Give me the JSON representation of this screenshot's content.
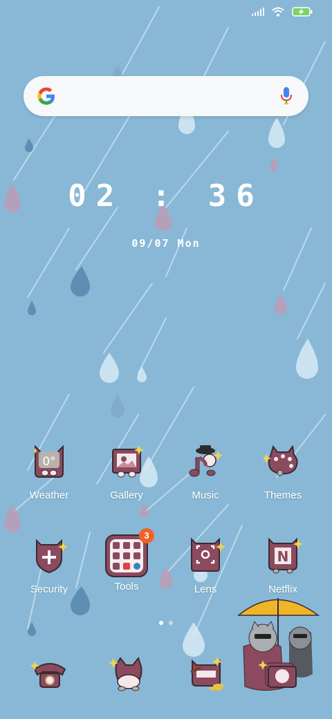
{
  "status_bar": {
    "signal_icon": "signal-icon",
    "wifi_icon": "wifi-icon",
    "battery_icon": "battery-charging-icon"
  },
  "search": {
    "logo": "google-g-icon",
    "mic": "mic-icon"
  },
  "clock": {
    "time": "02 : 36",
    "date": "09/07 Mon"
  },
  "apps": [
    {
      "label": "Weather",
      "icon": "weather-icon",
      "temp": "0°"
    },
    {
      "label": "Gallery",
      "icon": "gallery-icon"
    },
    {
      "label": "Music",
      "icon": "music-icon"
    },
    {
      "label": "Themes",
      "icon": "themes-icon"
    },
    {
      "label": "Security",
      "icon": "security-icon"
    },
    {
      "label": "Tools",
      "icon": "tools-folder-icon",
      "badge": "3"
    },
    {
      "label": "Lens",
      "icon": "lens-icon"
    },
    {
      "label": "Netflix",
      "icon": "netflix-icon",
      "glyph": "N"
    }
  ],
  "page_indicator": {
    "pages": 2,
    "current": 1
  },
  "dock": [
    "phone-icon",
    "messages-icon",
    "camera-icon",
    "browser-icon"
  ],
  "colors": {
    "background": "#88b8d6",
    "icon_plum": "#8b4a5e",
    "badge": "#f06323",
    "umbrella": "#f0b429"
  }
}
